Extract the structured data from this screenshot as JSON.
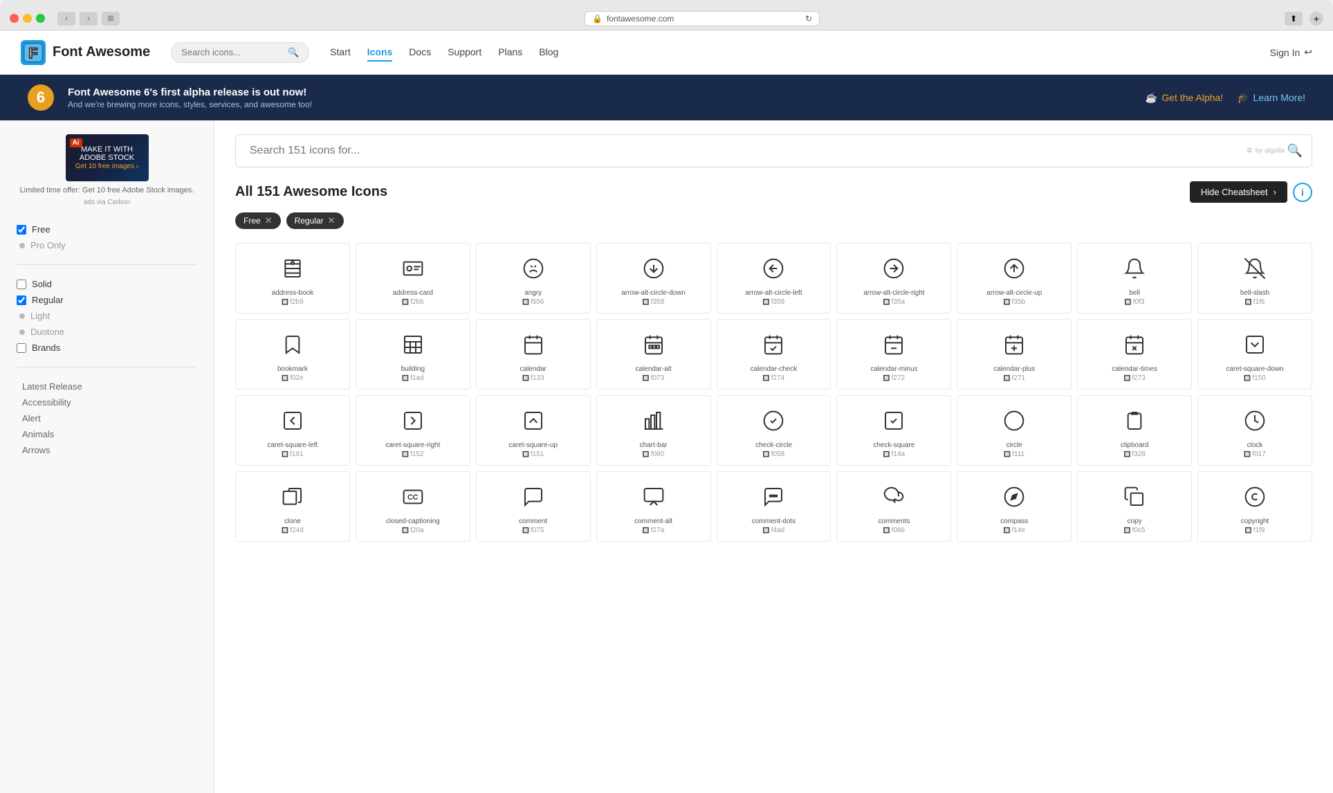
{
  "window": {
    "url": "fontawesome.com",
    "title": "Font Awesome"
  },
  "navbar": {
    "logo_letter": "F",
    "logo_text": "Font Awesome",
    "search_placeholder": "Search icons...",
    "links": [
      {
        "id": "start",
        "label": "Start",
        "active": false
      },
      {
        "id": "icons",
        "label": "Icons",
        "active": true
      },
      {
        "id": "docs",
        "label": "Docs",
        "active": false
      },
      {
        "id": "support",
        "label": "Support",
        "active": false
      },
      {
        "id": "plans",
        "label": "Plans",
        "active": false
      },
      {
        "id": "blog",
        "label": "Blog",
        "active": false
      }
    ],
    "signin_label": "Sign In"
  },
  "banner": {
    "number": "6",
    "headline": "Font Awesome 6's first alpha release is out now!",
    "subtext": "And we're brewing more icons, styles, services, and awesome too!",
    "alpha_btn": "Get the Alpha!",
    "learn_btn": "Learn More!"
  },
  "sidebar": {
    "ad": {
      "badge": "Ai",
      "main_text": "Limited time offer: Get 10 free Adobe Stock images.",
      "via_text": "ads via Carbon"
    },
    "filters": [
      {
        "id": "free",
        "label": "Free",
        "type": "checkbox",
        "checked": true
      },
      {
        "id": "pro-only",
        "label": "Pro Only",
        "type": "radio",
        "checked": false,
        "disabled": true
      },
      {
        "id": "solid",
        "label": "Solid",
        "type": "checkbox",
        "checked": false
      },
      {
        "id": "regular",
        "label": "Regular",
        "type": "checkbox",
        "checked": true
      },
      {
        "id": "light",
        "label": "Light",
        "type": "checkbox",
        "checked": false
      },
      {
        "id": "duotone",
        "label": "Duotone",
        "type": "checkbox",
        "checked": false
      },
      {
        "id": "brands",
        "label": "Brands",
        "type": "checkbox",
        "checked": false
      }
    ],
    "categories": [
      {
        "id": "latest-release",
        "label": "Latest Release"
      },
      {
        "id": "accessibility",
        "label": "Accessibility"
      },
      {
        "id": "alert",
        "label": "Alert"
      },
      {
        "id": "animals",
        "label": "Animals"
      },
      {
        "id": "arrows",
        "label": "Arrows"
      }
    ]
  },
  "main": {
    "search_placeholder": "Search 151 icons for...",
    "section_title": "All 151 Awesome Icons",
    "cheatsheet_btn": "Hide Cheatsheet",
    "filter_tags": [
      {
        "id": "free-tag",
        "label": "Free"
      },
      {
        "id": "regular-tag",
        "label": "Regular"
      }
    ],
    "icons": [
      {
        "id": "address-book",
        "name": "address-book",
        "code": "f2b9",
        "symbol": "📖"
      },
      {
        "id": "address-card",
        "name": "address-card",
        "code": "f2bb",
        "symbol": "🪪"
      },
      {
        "id": "angry",
        "name": "angry",
        "code": "f556",
        "symbol": "😠"
      },
      {
        "id": "arrow-alt-circle-down",
        "name": "arrow-alt-circle-down",
        "code": "f358",
        "symbol": "⬇"
      },
      {
        "id": "arrow-alt-circle-left",
        "name": "arrow-alt-circle-left",
        "code": "f359",
        "symbol": "⬅"
      },
      {
        "id": "arrow-alt-circle-right",
        "name": "arrow-alt-circle-right",
        "code": "f35a",
        "symbol": "➡"
      },
      {
        "id": "arrow-alt-circle-up",
        "name": "arrow-alt-circle-up",
        "code": "f35b",
        "symbol": "⬆"
      },
      {
        "id": "bell",
        "name": "bell",
        "code": "f0f3",
        "symbol": "🔔"
      },
      {
        "id": "bell-slash",
        "name": "bell-slash",
        "code": "f1f6",
        "symbol": "🔕"
      },
      {
        "id": "bookmark",
        "name": "bookmark",
        "code": "f02e",
        "symbol": "🔖"
      },
      {
        "id": "building",
        "name": "building",
        "code": "f1ad",
        "symbol": "🏢"
      },
      {
        "id": "calendar",
        "name": "calendar",
        "code": "f133",
        "symbol": "📅"
      },
      {
        "id": "calendar-alt",
        "name": "calendar-alt",
        "code": "f073",
        "symbol": "📆"
      },
      {
        "id": "calendar-check",
        "name": "calendar-check",
        "code": "f274",
        "symbol": "✅"
      },
      {
        "id": "calendar-minus",
        "name": "calendar-minus",
        "code": "f272",
        "symbol": "➖"
      },
      {
        "id": "calendar-plus",
        "name": "calendar-plus",
        "code": "f271",
        "symbol": "➕"
      },
      {
        "id": "calendar-times",
        "name": "calendar-times",
        "code": "f273",
        "symbol": "✖"
      },
      {
        "id": "caret-square-down",
        "name": "caret-square-down",
        "code": "f150",
        "symbol": "⬇"
      },
      {
        "id": "caret-square-left",
        "name": "caret-square-left",
        "code": "f191",
        "symbol": "⬅"
      },
      {
        "id": "caret-square-right",
        "name": "caret-square-right",
        "code": "f152",
        "symbol": "➡"
      },
      {
        "id": "caret-square-up",
        "name": "caret-square-up",
        "code": "f151",
        "symbol": "⬆"
      },
      {
        "id": "chart-bar",
        "name": "chart-bar",
        "code": "f080",
        "symbol": "📊"
      },
      {
        "id": "check-circle",
        "name": "check-circle",
        "code": "f058",
        "symbol": "✔"
      },
      {
        "id": "check-square",
        "name": "check-square",
        "code": "f14a",
        "symbol": "☑"
      },
      {
        "id": "circle",
        "name": "circle",
        "code": "f111",
        "symbol": "⭕"
      },
      {
        "id": "clipboard",
        "name": "clipboard",
        "code": "f328",
        "symbol": "📋"
      },
      {
        "id": "clock",
        "name": "clock",
        "code": "f017",
        "symbol": "🕐"
      },
      {
        "id": "clone",
        "name": "clone",
        "code": "f24d",
        "symbol": "⧉"
      },
      {
        "id": "closed-captioning",
        "name": "closed-captioning",
        "code": "f20a",
        "symbol": "CC"
      },
      {
        "id": "comment",
        "name": "comment",
        "code": "f075",
        "symbol": "💬"
      },
      {
        "id": "comment-alt",
        "name": "comment-alt",
        "code": "f27a",
        "symbol": "🗨"
      },
      {
        "id": "comment-dots",
        "name": "comment-dots",
        "code": "f4ad",
        "symbol": "💭"
      },
      {
        "id": "comments",
        "name": "comments",
        "code": "f086",
        "symbol": "🗪"
      },
      {
        "id": "compass",
        "name": "compass",
        "code": "f14e",
        "symbol": "🧭"
      },
      {
        "id": "copy",
        "name": "copy",
        "code": "f0c5",
        "symbol": "📄"
      },
      {
        "id": "copyright",
        "name": "copyright",
        "code": "f1f9",
        "symbol": "©"
      }
    ]
  },
  "colors": {
    "accent_blue": "#1c9be6",
    "dark_navy": "#1a2a4a",
    "orange": "#e8a020",
    "text_dark": "#222",
    "text_mid": "#555",
    "text_light": "#999"
  }
}
